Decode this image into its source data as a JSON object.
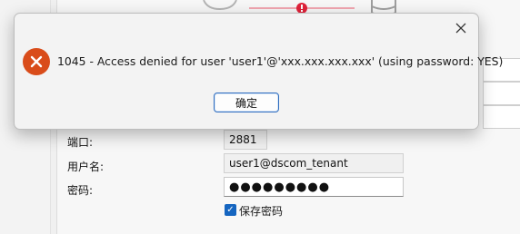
{
  "background_form": {
    "port_label": "端口:",
    "port_value": "2881",
    "username_label": "用户名:",
    "username_value": "user1@dscom_tenant",
    "password_label": "密码:",
    "password_value": "●●●●●●●●●",
    "save_password_label": "保存密码",
    "save_password_checked": true
  },
  "dialog": {
    "icon": "error-x-icon",
    "message": "1045 - Access denied for user 'user1'@'xxx.xxx.xxx.xxx' (using password: YES)",
    "ok_label": "确定",
    "close_icon": "close-icon"
  },
  "colors": {
    "error_icon": "#d94c1a",
    "accent": "#2f6dbf",
    "checkbox": "#1565c0",
    "connection_error_dot": "#e0223a"
  }
}
